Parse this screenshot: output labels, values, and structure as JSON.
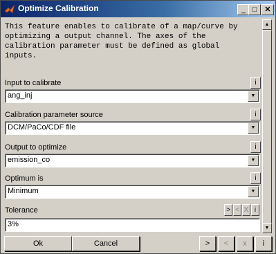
{
  "window": {
    "title": "Optimize Calibration",
    "buttons": {
      "minimize": "_",
      "maximize": "□",
      "close": "✕"
    }
  },
  "description": "This feature enables to calibrate of a map/curve by\noptimizing a output channel. The axes of the\ncalibration parameter must be defined as global\ninputs.",
  "fields": [
    {
      "label": "Input to calibrate",
      "value": "ang_inj",
      "info": "i"
    },
    {
      "label": "Calibration parameter source",
      "value": "DCM/PaCo/CDF file",
      "info": "i"
    },
    {
      "label": "Output to optimize",
      "value": "emission_co",
      "info": "i"
    },
    {
      "label": "Optimum is",
      "value": "Minimum",
      "info": "i"
    }
  ],
  "tolerance": {
    "label": "Tolerance",
    "value": "3%",
    "buttons": {
      "next": ">",
      "prev": "<",
      "clear": "X",
      "info": "i"
    }
  },
  "footer": {
    "ok": "Ok",
    "cancel": "Cancel",
    "next": ">",
    "prev": "<",
    "clear": "x",
    "info": "i"
  },
  "icons": {
    "dropdown": "triangle-down",
    "scroll_up": "triangle-up",
    "scroll_down": "triangle-down",
    "app": "matlab-logo"
  }
}
